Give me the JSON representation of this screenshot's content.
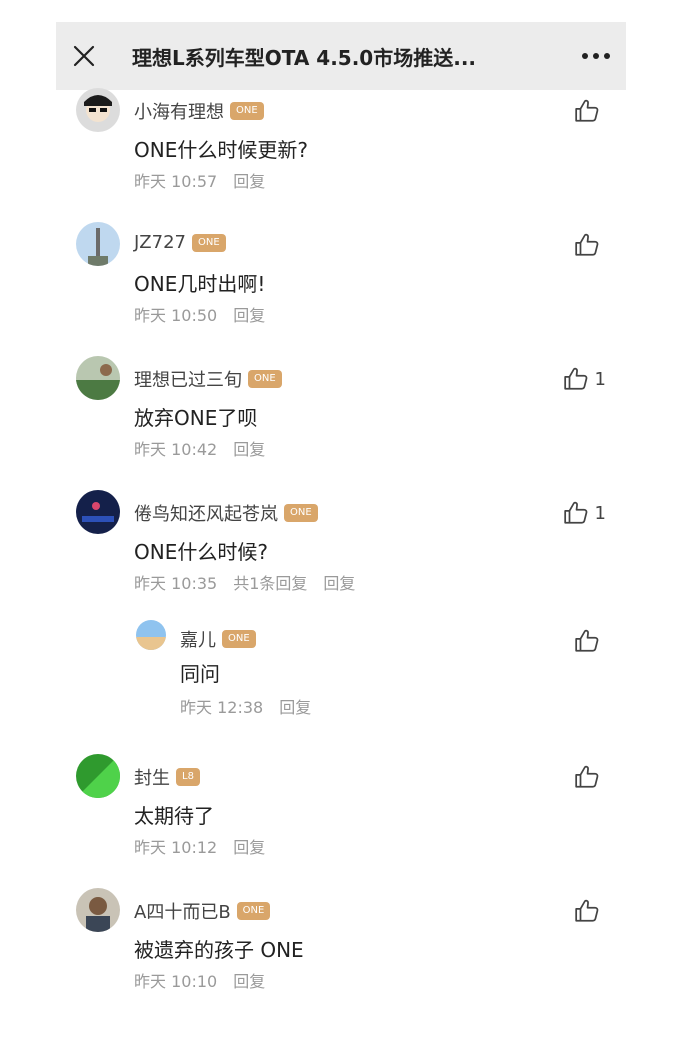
{
  "header": {
    "title": "理想L系列车型OTA 4.5.0市场推送..."
  },
  "comments": [
    {
      "user": "小海有理想",
      "badge": "ONE",
      "text": "ONE什么时候更新?",
      "time": "昨天 10:57",
      "replies_count": "",
      "reply_label": "回复",
      "likes": ""
    },
    {
      "user": "JZ727",
      "badge": "ONE",
      "text": "ONE几时出啊!",
      "time": "昨天 10:50",
      "replies_count": "",
      "reply_label": "回复",
      "likes": ""
    },
    {
      "user": "理想已过三旬",
      "badge": "ONE",
      "text": "放弃ONE了呗",
      "time": "昨天 10:42",
      "replies_count": "",
      "reply_label": "回复",
      "likes": "1"
    },
    {
      "user": "倦鸟知还风起苍岚",
      "badge": "ONE",
      "text": "ONE什么时候?",
      "time": "昨天 10:35",
      "replies_count": "共1条回复",
      "reply_label": "回复",
      "likes": "1"
    },
    {
      "user": "嘉儿",
      "badge": "ONE",
      "text": "同问",
      "time": "昨天 12:38",
      "replies_count": "",
      "reply_label": "回复",
      "likes": ""
    },
    {
      "user": "封生",
      "badge": "L8",
      "text": "太期待了",
      "time": "昨天 10:12",
      "replies_count": "",
      "reply_label": "回复",
      "likes": ""
    },
    {
      "user": "A四十而已B",
      "badge": "ONE",
      "text": "被遗弃的孩子  ONE",
      "time": "昨天 10:10",
      "replies_count": "",
      "reply_label": "回复",
      "likes": ""
    }
  ]
}
